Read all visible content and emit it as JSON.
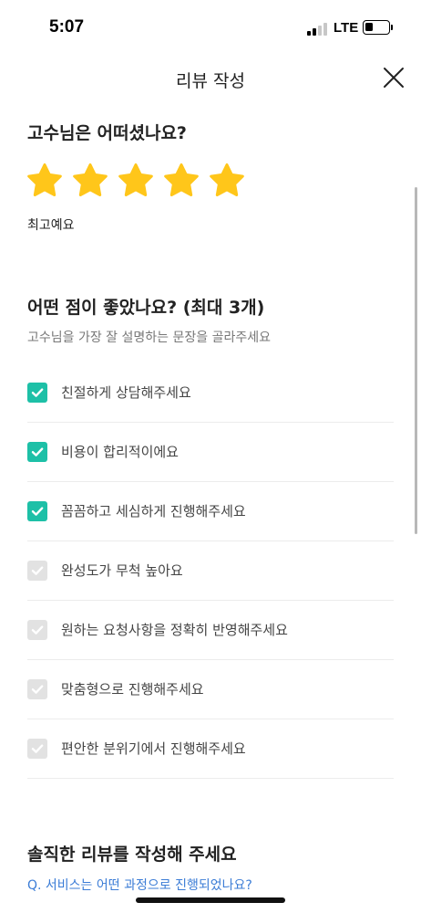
{
  "status": {
    "time": "5:07",
    "network": "LTE"
  },
  "nav": {
    "title": "리뷰 작성",
    "close_icon": "close-icon"
  },
  "rating": {
    "question": "고수님은 어떠셨나요?",
    "stars": 5,
    "max_stars": 5,
    "label": "최고예요",
    "star_color": "#ffc61a"
  },
  "good_points": {
    "title": "어떤 점이 좋았나요? (최대 3개)",
    "subtitle": "고수님을 가장 잘 설명하는 문장을 골라주세요",
    "checked_color": "#1dc0a7",
    "options": [
      {
        "label": "친절하게 상담해주세요",
        "checked": true
      },
      {
        "label": "비용이 합리적이에요",
        "checked": true
      },
      {
        "label": "꼼꼼하고 세심하게 진행해주세요",
        "checked": true
      },
      {
        "label": "완성도가 무척 높아요",
        "checked": false
      },
      {
        "label": "원하는 요청사항을 정확히 반영해주세요",
        "checked": false
      },
      {
        "label": "맞춤형으로 진행해주세요",
        "checked": false
      },
      {
        "label": "편안한 분위기에서 진행해주세요",
        "checked": false
      }
    ]
  },
  "review": {
    "title": "솔직한 리뷰를 작성해 주세요",
    "prompt": "Q. 서비스는 어떤 과정으로 진행되었나요?"
  }
}
